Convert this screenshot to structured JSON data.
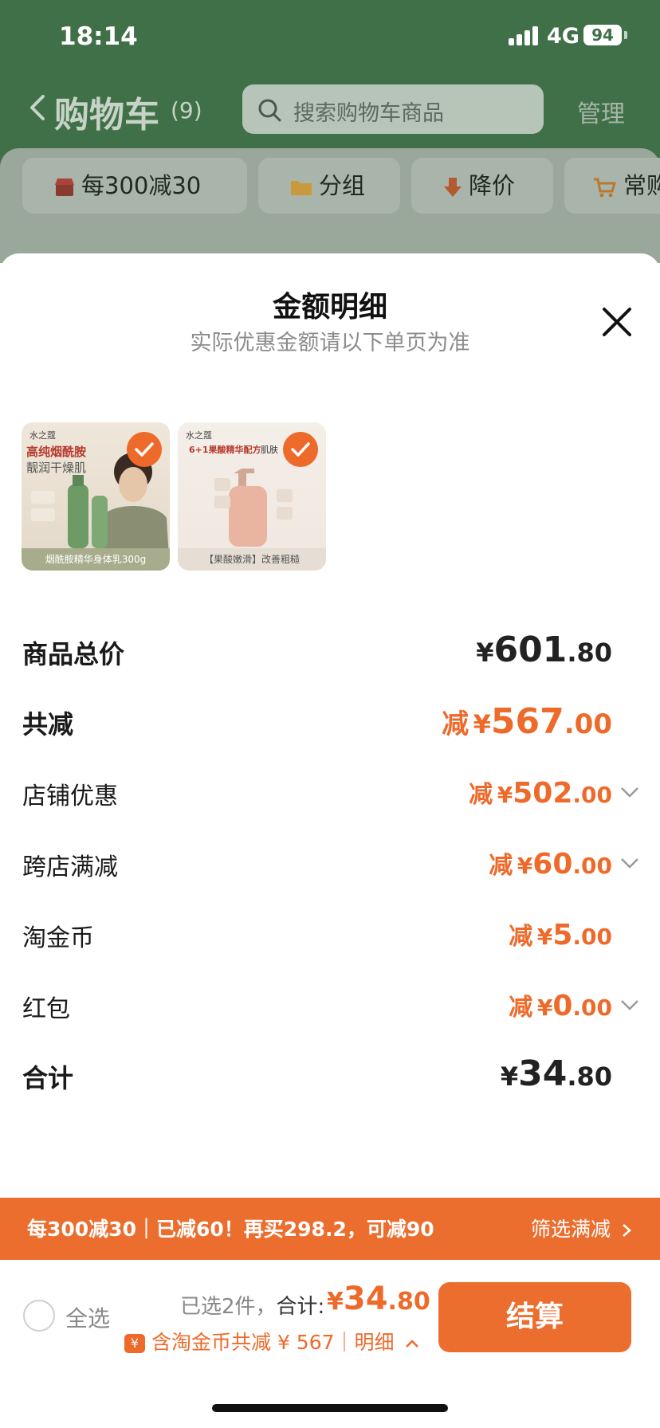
{
  "status_bar": {
    "time": "18:14",
    "network": "4G",
    "battery": "94"
  },
  "cart_header": {
    "title": "购物车",
    "count": "(9)",
    "search_placeholder": "搜索购物车商品",
    "manage": "管理"
  },
  "chips": [
    {
      "label": "每300减30",
      "icon": "store-icon"
    },
    {
      "label": "分组",
      "icon": "folder-icon"
    },
    {
      "label": "降价",
      "icon": "price-drop-icon"
    },
    {
      "label": "常购",
      "icon": "cart-plus-icon"
    }
  ],
  "sheet": {
    "title": "金额明细",
    "subtitle": "实际优惠金额请以下单页为准",
    "products": [
      {
        "brand": "水之蔻",
        "headline": "高纯烟酰胺",
        "sub": "靓润干燥肌",
        "caption": "烟酰胺精华身体乳300g",
        "checked": true
      },
      {
        "brand": "水之蔻",
        "headline": "6+1果酸精华配方",
        "sub": "肌肤",
        "caption": "【果酸嫩滑】改善粗糙",
        "checked": true
      }
    ],
    "rows": {
      "goods_total": {
        "label": "商品总价",
        "prefix": "",
        "currency": "¥",
        "int": "601",
        "dec": ".80"
      },
      "total_off": {
        "label": "共减",
        "prefix": "减",
        "currency": "¥",
        "int": "567",
        "dec": ".00"
      },
      "store_discount": {
        "label": "店铺优惠",
        "prefix": "减",
        "currency": "¥",
        "int": "502",
        "dec": ".00"
      },
      "cross_store": {
        "label": "跨店满减",
        "prefix": "减",
        "currency": "¥",
        "int": "60",
        "dec": ".00"
      },
      "taojinbi": {
        "label": "淘金币",
        "prefix": "减",
        "currency": "¥",
        "int": "5",
        "dec": ".00"
      },
      "red_packet": {
        "label": "红包",
        "prefix": "减",
        "currency": "¥",
        "int": "0",
        "dec": ".00"
      },
      "sum": {
        "label": "合计",
        "prefix": "",
        "currency": "¥",
        "int": "34",
        "dec": ".80"
      }
    }
  },
  "promo": {
    "text": "每300减30｜已减60！再买298.2，可减90",
    "link": "筛选满减"
  },
  "bottom": {
    "select_all": "全选",
    "selected_info": "已选2件，",
    "total_label": "合计:",
    "price_currency": "¥",
    "price_int": "34",
    "price_dec": ".80",
    "coin_badge": "¥",
    "coin_text": "含淘金币共减 ¥ 567｜明细",
    "checkout": "结算"
  },
  "colors": {
    "accent": "#ee6a2b",
    "header_green": "#3f7048"
  }
}
